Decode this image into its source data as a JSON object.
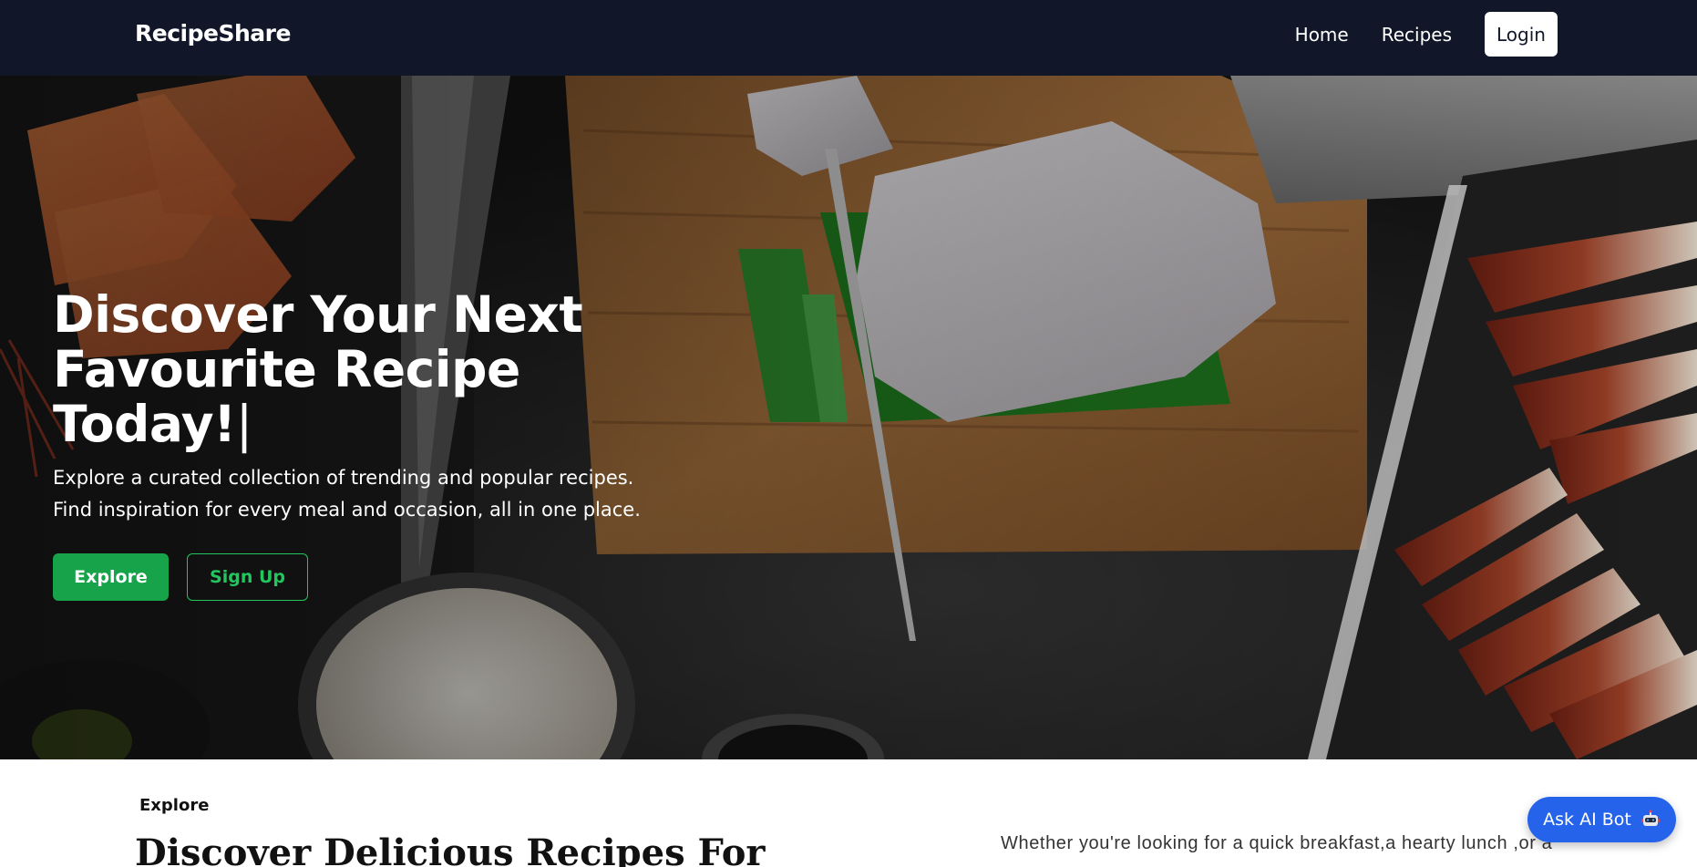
{
  "navbar": {
    "brand": "RecipeShare",
    "links": [
      {
        "label": "Home"
      },
      {
        "label": "Recipes"
      }
    ],
    "login_label": "Login"
  },
  "hero": {
    "title_line1": "Discover Your Next",
    "title_line2": "Favourite Recipe Today!",
    "cursor": "|",
    "subtitle": "Explore a curated collection of trending and popular recipes. Find inspiration for every meal and occasion, all in one place.",
    "explore_label": "Explore",
    "signup_label": "Sign Up"
  },
  "section": {
    "eyebrow": "Explore",
    "title": "Discover Delicious Recipes For",
    "text": "Whether you're looking for a quick breakfast,a hearty lunch ,or a"
  },
  "ai_bot": {
    "label": "Ask AI Bot",
    "icon": "robot-icon"
  },
  "colors": {
    "navbar_bg": "#111729",
    "explore_green": "#16a34a",
    "signup_green": "#22c55e",
    "ai_bot_blue": "#2563eb"
  }
}
